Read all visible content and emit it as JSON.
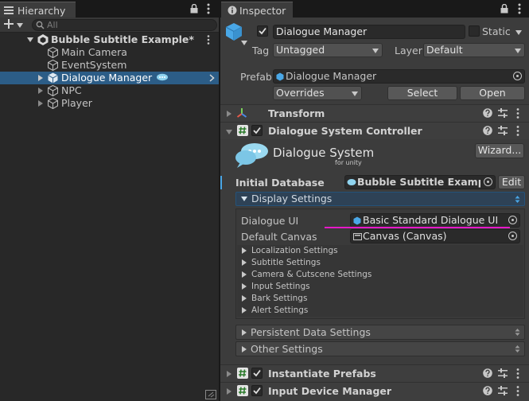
{
  "hierarchy": {
    "tab_label": "Hierarchy",
    "search_placeholder": "All",
    "scene_name": "Bubble Subtitle Example*",
    "items": [
      {
        "label": "Main Camera"
      },
      {
        "label": "EventSystem"
      },
      {
        "label": "Dialogue Manager"
      },
      {
        "label": "NPC"
      },
      {
        "label": "Player"
      }
    ]
  },
  "inspector": {
    "tab_label": "Inspector",
    "object_name": "Dialogue Manager",
    "static_label": "Static",
    "tag_label": "Tag",
    "tag_value": "Untagged",
    "layer_label": "Layer",
    "layer_value": "Default",
    "prefab_label": "Prefab",
    "prefab_value": "Dialogue Manager",
    "overrides_label": "Overrides",
    "select_label": "Select",
    "open_label": "Open",
    "components": {
      "transform": "Transform",
      "controller": "Dialogue System Controller",
      "instantiate": "Instantiate Prefabs",
      "input": "Input Device Manager"
    },
    "logo_title": "Dialogue System",
    "logo_sub": "for unity",
    "wizard_label": "Wizard...",
    "initial_db_label": "Initial Database",
    "initial_db_value": "Bubble Subtitle Example D",
    "edit_label": "Edit",
    "display_settings_label": "Display Settings",
    "dialogue_ui_label": "Dialogue UI",
    "dialogue_ui_value": "Basic Standard Dialogue UI",
    "default_canvas_label": "Default Canvas",
    "default_canvas_value": "Canvas (Canvas)",
    "sub_sections": [
      "Localization Settings",
      "Subtitle Settings",
      "Camera & Cutscene Settings",
      "Input Settings",
      "Bark Settings",
      "Alert Settings"
    ],
    "persistent_label": "Persistent Data Settings",
    "other_label": "Other Settings"
  },
  "colors": {
    "selection": "#2c5d87",
    "accent_blue": "#4aa7e6",
    "underline_magenta": "#e619c8"
  }
}
